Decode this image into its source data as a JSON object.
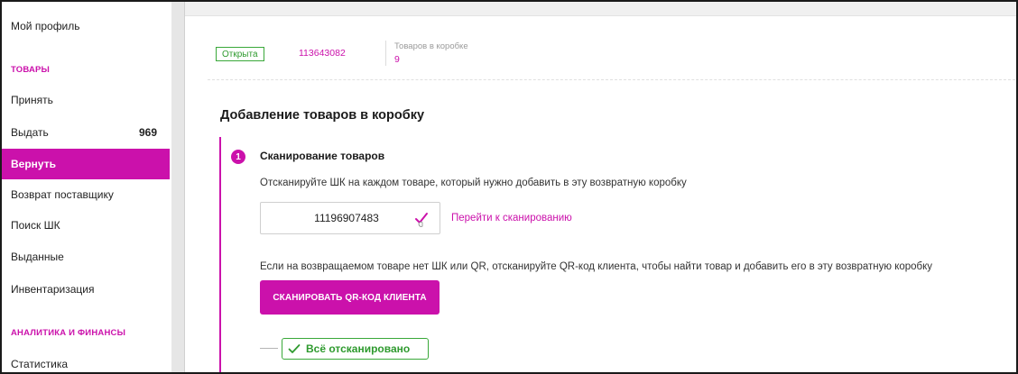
{
  "sidebar": {
    "my_profile": "Мой профиль",
    "section_goods": "Товары",
    "items": [
      {
        "label": "Принять",
        "count": ""
      },
      {
        "label": "Выдать",
        "count": "969"
      },
      {
        "label": "Вернуть",
        "count": "",
        "active": true
      },
      {
        "label": "Возврат поставщику",
        "count": ""
      },
      {
        "label": "Поиск ШК",
        "count": ""
      },
      {
        "label": "Выданные",
        "count": ""
      },
      {
        "label": "Инвентаризация",
        "count": ""
      }
    ],
    "section_analytics": "Аналитика и финансы",
    "analytics_items": [
      {
        "label": "Статистика"
      }
    ]
  },
  "box": {
    "status": "Открыта",
    "id": "113643082",
    "items_label": "Товаров в коробке",
    "items_count": "9"
  },
  "main": {
    "title": "Добавление товаров в коробку",
    "step": {
      "number": "1",
      "title": "Сканирование товаров",
      "instruction": "Отсканируйте ШК на каждом товаре, который нужно добавить в эту возвратную коробку",
      "barcode_value": "11196907483",
      "goto_scan": "Перейти к сканированию",
      "instruction_qr": "Если на возвращаемом товаре нет ШК или QR, отсканируйте QR-код клиента, чтобы найти товар и добавить его в эту возвратную коробку",
      "qr_button": "Сканировать QR-код клиента",
      "done_label": "Всё отсканировано"
    }
  },
  "colors": {
    "accent": "#cb11ab",
    "success": "#39a839"
  },
  "icons": [
    "check-icon",
    "checkmark-icon"
  ]
}
